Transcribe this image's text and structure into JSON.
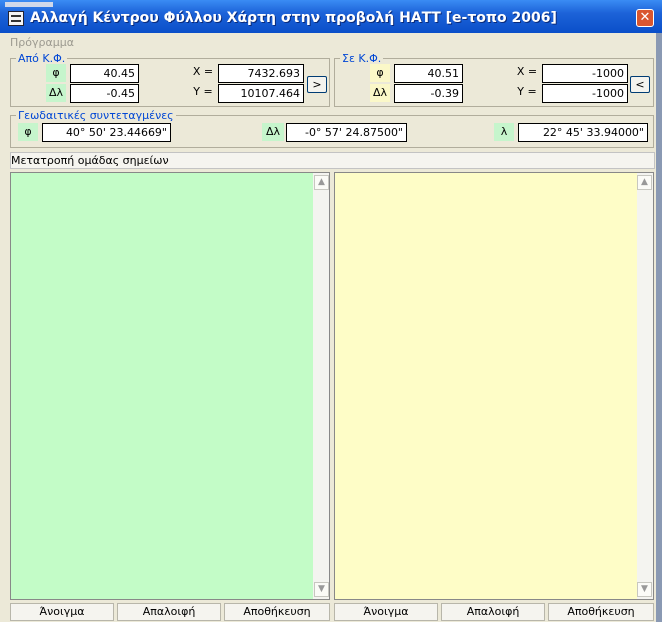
{
  "window": {
    "title": "Αλλαγή Κέντρου Φύλλου Χάρτη στην προβολή ΗΑΤΤ [e-τοπο 2006]",
    "close_label": "✕"
  },
  "menu": {
    "items": [
      {
        "label": "Πρόγραμμα"
      }
    ]
  },
  "from_group": {
    "legend": "Από Κ.Φ.",
    "phi_label": "φ",
    "phi_value": "40.45",
    "dlambda_label": "Δλ",
    "dlambda_value": "-0.45",
    "x_label": "X =",
    "x_value": "7432.693",
    "y_label": "Y =",
    "y_value": "10107.464",
    "transfer_label": ">"
  },
  "to_group": {
    "legend": "Σε Κ.Φ.",
    "phi_label": "φ",
    "phi_value": "40.51",
    "dlambda_label": "Δλ",
    "dlambda_value": "-0.39",
    "x_label": "X =",
    "x_value": "-1000",
    "y_label": "Y =",
    "y_value": "-1000",
    "transfer_label": "<"
  },
  "geodetic_group": {
    "legend": "Γεωδαιτικές συντεταγμένες",
    "phi_label": "φ",
    "phi_value": "40° 50' 23.44669\"",
    "dlambda_label": "Δλ",
    "dlambda_value": "-0° 57' 24.87500\"",
    "lambda_label": "λ",
    "lambda_value": "22° 45' 33.94000\""
  },
  "convert_button": {
    "label": "Μετατροπή ομάδας σημείων"
  },
  "left_panel": {
    "open_label": "Άνοιγμα",
    "clear_label": "Απαλοιφή",
    "save_label": "Αποθήκευση",
    "color": "#c3fcc7"
  },
  "right_panel": {
    "open_label": "Άνοιγμα",
    "clear_label": "Απαλοιφή",
    "save_label": "Αποθήκευση",
    "color": "#fefdc7"
  },
  "icons": {
    "app": "app-icon",
    "close": "close-icon",
    "scroll_up": "up-arrow",
    "scroll_down": "down-arrow"
  },
  "scroll": {
    "up": "▲",
    "down": "▼"
  }
}
